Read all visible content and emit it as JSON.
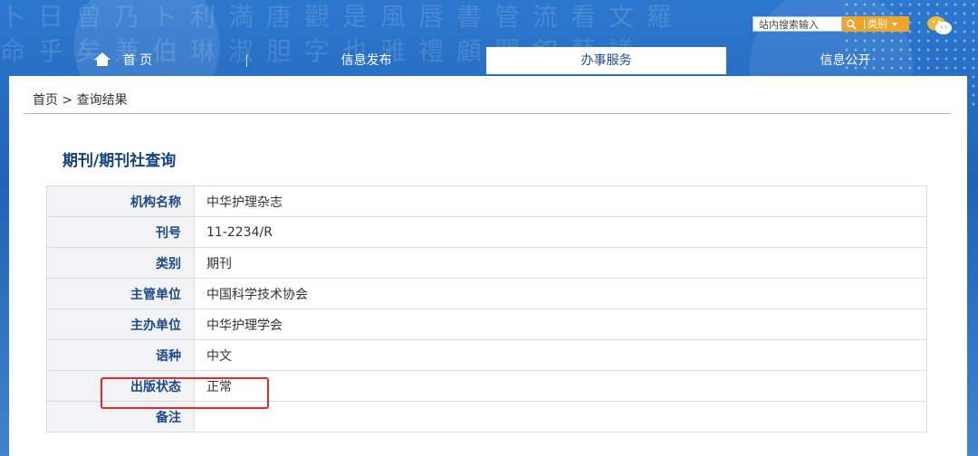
{
  "header": {
    "search": {
      "placeholder": "站内搜索输入"
    },
    "category": {
      "label": "类别"
    },
    "icons": {
      "search": "search-icon",
      "wechat": "wechat-icon",
      "home": "home-icon"
    }
  },
  "nav": {
    "items": [
      {
        "label": "首 页"
      },
      {
        "label": "信息发布"
      },
      {
        "label": "办事服务"
      },
      {
        "label": "信息公开"
      }
    ],
    "active_index": 2
  },
  "breadcrumb": {
    "home": "首页",
    "separator": ">",
    "current": "查询结果"
  },
  "page": {
    "title": "期刊/期刊社查询"
  },
  "table": {
    "rows": [
      {
        "label": "机构名称",
        "value": "中华护理杂志"
      },
      {
        "label": "刊号",
        "value": "11-2234/R"
      },
      {
        "label": "类别",
        "value": "期刊"
      },
      {
        "label": "主管单位",
        "value": "中国科学技术协会"
      },
      {
        "label": "主办单位",
        "value": "中华护理学会"
      },
      {
        "label": "语种",
        "value": "中文"
      },
      {
        "label": "出版状态",
        "value": "正常"
      },
      {
        "label": "备注",
        "value": ""
      }
    ]
  },
  "colors": {
    "header_blue": "#1f63b7",
    "accent_orange": "#f0a52a",
    "title_blue": "#14427e",
    "highlight_red": "#e8262b"
  }
}
